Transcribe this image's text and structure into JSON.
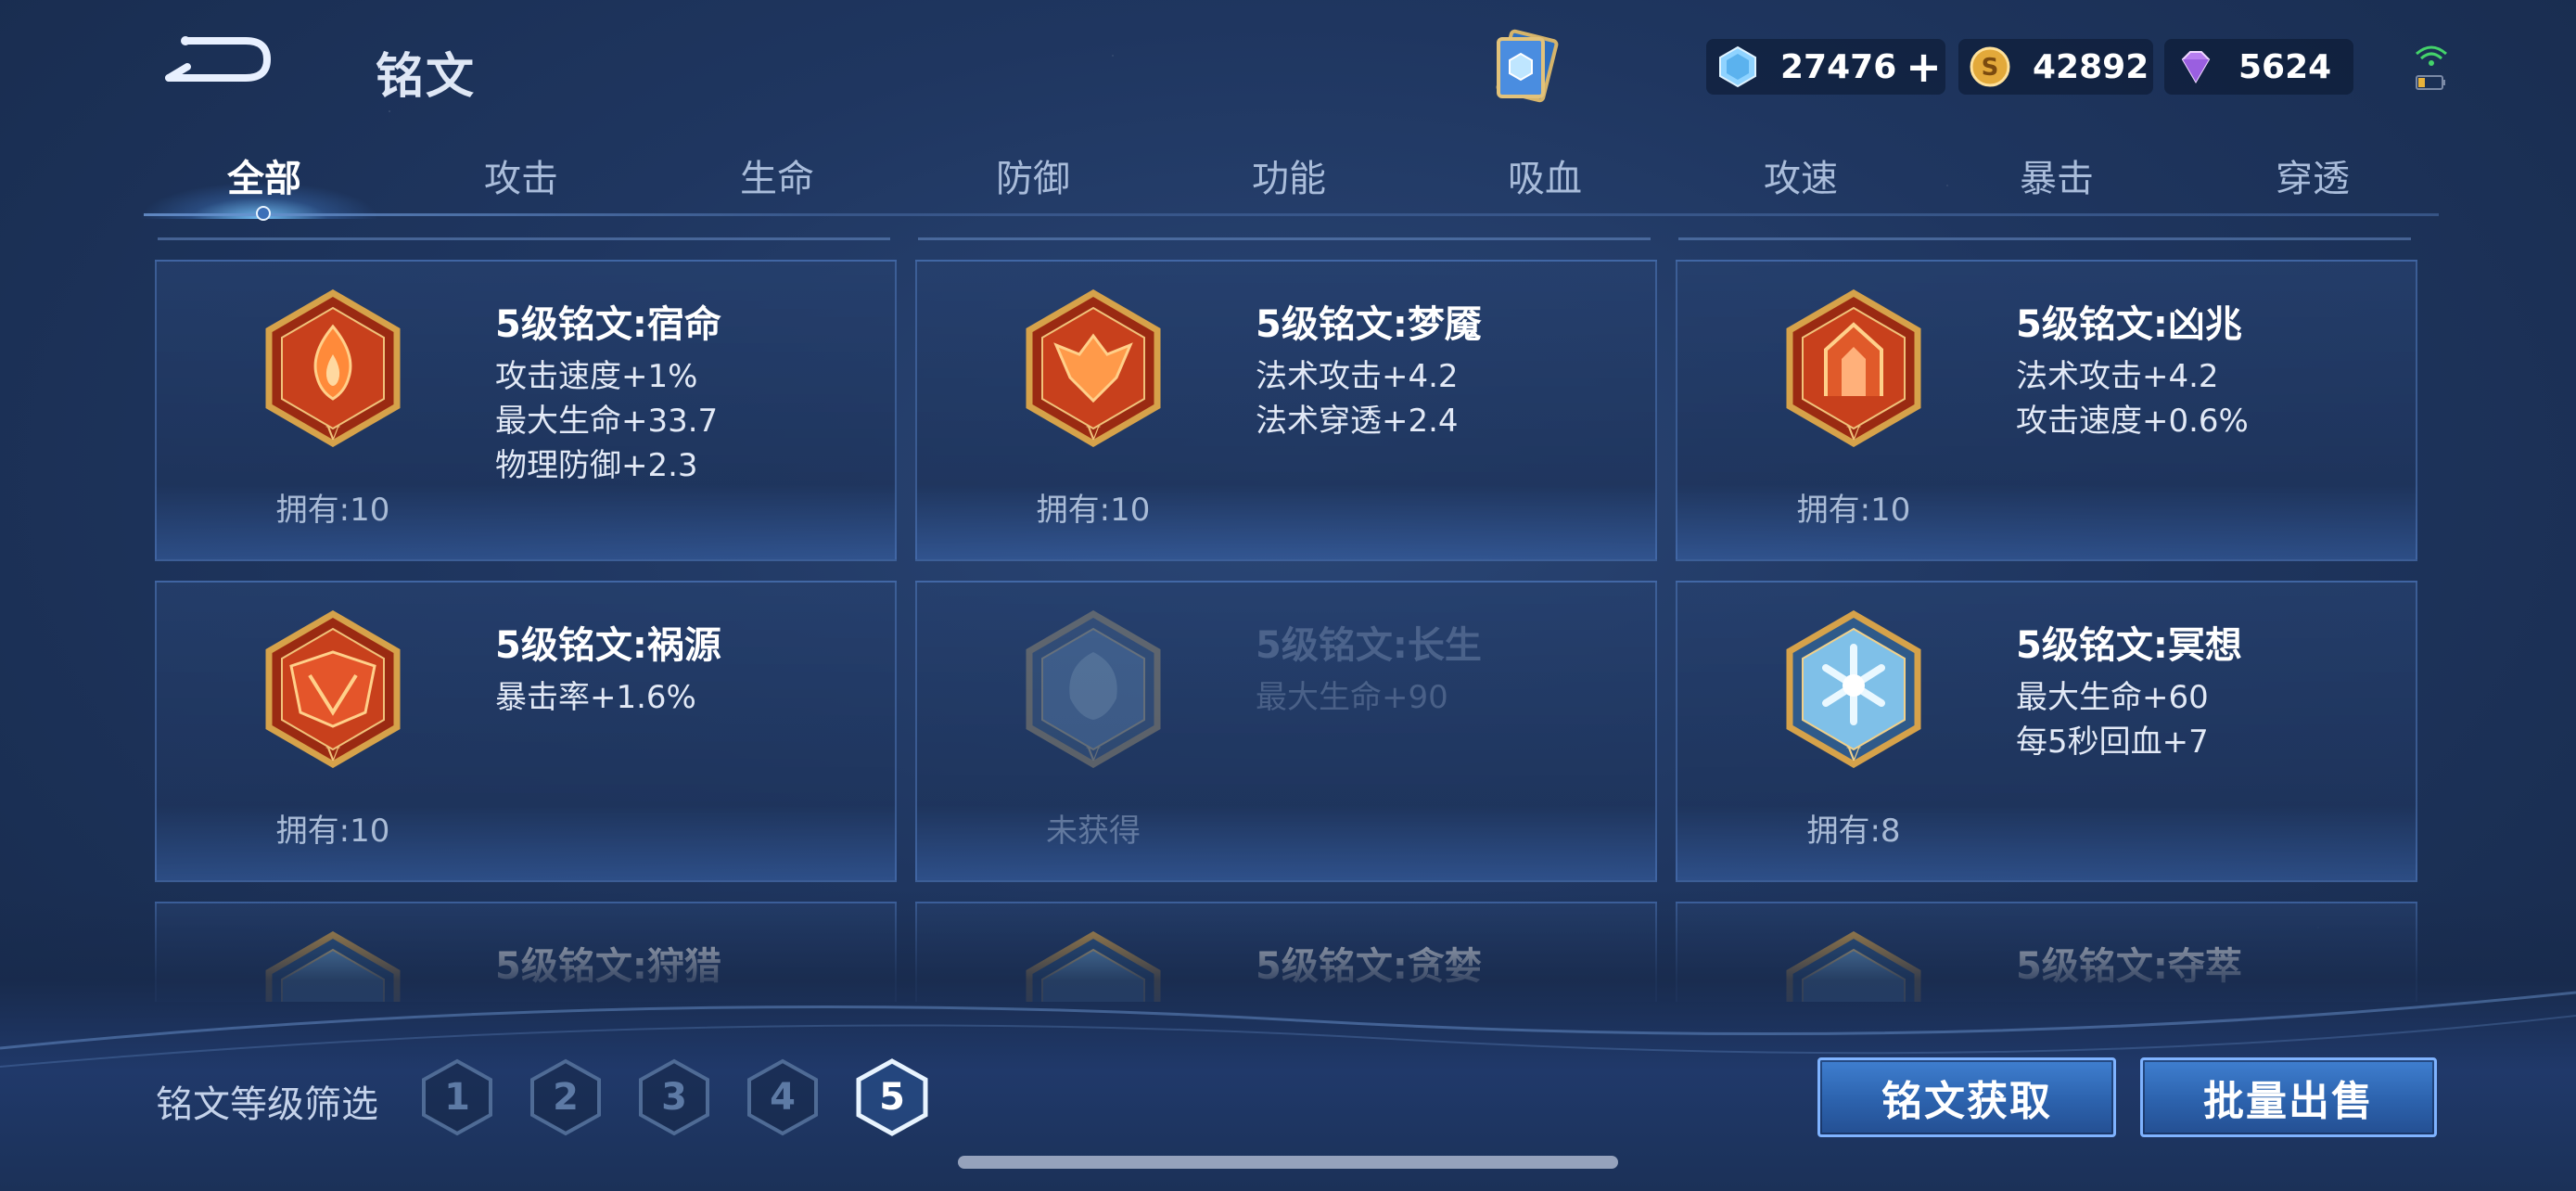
{
  "header": {
    "title": "铭文",
    "currencies": [
      {
        "icon": "crystal-icon",
        "value": "27476",
        "has_plus": true
      },
      {
        "icon": "gold-coin-icon",
        "value": "42892"
      },
      {
        "icon": "diamond-icon",
        "value": "5624"
      }
    ]
  },
  "tabs": [
    "全部",
    "攻击",
    "生命",
    "防御",
    "功能",
    "吸血",
    "攻速",
    "暴击",
    "穿透"
  ],
  "active_tab": "全部",
  "runes": [
    {
      "name": "5级铭文:宿命",
      "attrs": [
        "攻击速度+1%",
        "最大生命+33.7",
        "物理防御+2.3"
      ],
      "owned": "拥有:10",
      "color": "red",
      "locked": false
    },
    {
      "name": "5级铭文:梦魇",
      "attrs": [
        "法术攻击+4.2",
        "法术穿透+2.4"
      ],
      "owned": "拥有:10",
      "color": "red",
      "locked": false
    },
    {
      "name": "5级铭文:凶兆",
      "attrs": [
        "法术攻击+4.2",
        "攻击速度+0.6%"
      ],
      "owned": "拥有:10",
      "color": "red",
      "locked": false
    },
    {
      "name": "5级铭文:祸源",
      "attrs": [
        "暴击率+1.6%"
      ],
      "owned": "拥有:10",
      "color": "red",
      "locked": false
    },
    {
      "name": "5级铭文:长生",
      "attrs": [
        "最大生命+90"
      ],
      "owned": "未获得",
      "color": "blue",
      "locked": true
    },
    {
      "name": "5级铭文:冥想",
      "attrs": [
        "最大生命+60",
        "每5秒回血+7"
      ],
      "owned": "拥有:8",
      "color": "blue",
      "locked": false
    },
    {
      "name": "5级铭文:狩猎",
      "attrs": [],
      "owned": "",
      "color": "blue",
      "locked": false
    },
    {
      "name": "5级铭文:贪婪",
      "attrs": [],
      "owned": "",
      "color": "blue",
      "locked": false
    },
    {
      "name": "5级铭文:夺萃",
      "attrs": [],
      "owned": "",
      "color": "blue",
      "locked": false
    }
  ],
  "filter": {
    "label": "铭文等级筛选",
    "levels": [
      "1",
      "2",
      "3",
      "4",
      "5"
    ],
    "active_level": "5"
  },
  "buttons": {
    "get": "铭文获取",
    "sell": "批量出售"
  },
  "colors": {
    "accent_blue": "#3f7fd0",
    "rune_red": "#c8401c",
    "rune_blue": "#7fc0e8",
    "gold_frame": "#d6a24a"
  }
}
